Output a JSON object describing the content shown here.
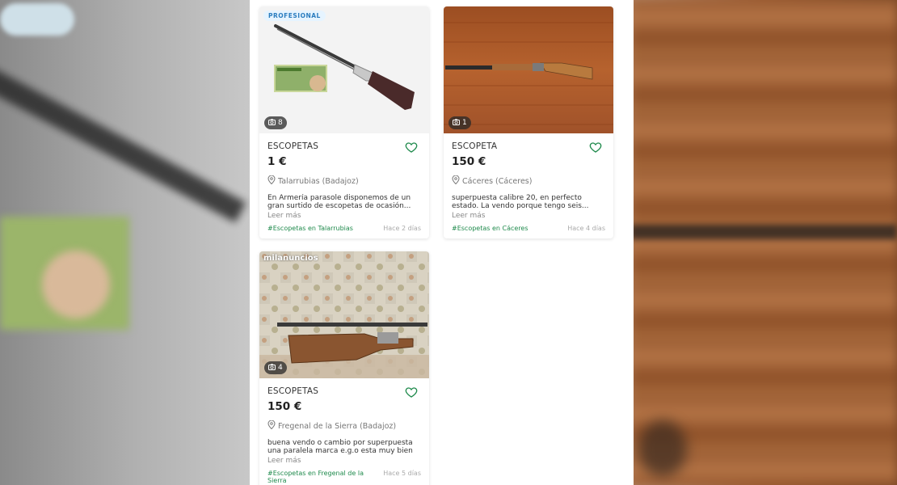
{
  "listings": [
    {
      "badge": "PROFESIONAL",
      "photo_count": "8",
      "category": "ESCOPETAS",
      "price": "1 €",
      "location": "Talarrubias (Badajoz)",
      "description": "En Armería parasole disponemos de un gran surtido de escopetas de ocasión...",
      "read_more": "Leer más",
      "tag": "#Escopetas en Talarrubias",
      "date": "Hace 2 días"
    },
    {
      "photo_count": "1",
      "category": "ESCOPETA",
      "price": "150 €",
      "location": "Cáceres (Cáceres)",
      "description": "superpuesta calibre 20, en perfecto estado. La vendo porque tengo seis...",
      "read_more": "Leer más",
      "tag": "#Escopetas en Cáceres",
      "date": "Hace 4 días"
    },
    {
      "watermark": "milanuncios",
      "photo_count": "4",
      "category": "ESCOPETAS",
      "price": "150 €",
      "location": "Fregenal de la Sierra (Badajoz)",
      "description": "buena vendo o cambio por superpuesta una paralela marca e.g.o esta muy bien ...",
      "read_more": "Leer más",
      "tag": "#Escopetas en Fregenal de la Sierra",
      "date": "Hace 5 días"
    }
  ],
  "colors": {
    "accent_green": "#1f8a4c",
    "badge_blue": "#2b7dbf"
  },
  "icons": [
    "camera-icon",
    "heart-icon",
    "location-pin-icon"
  ]
}
